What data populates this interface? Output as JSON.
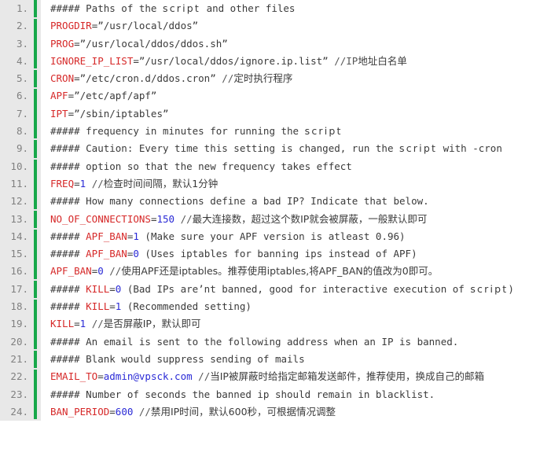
{
  "editor": {
    "kind": "code-listing",
    "language": "shell-config",
    "colors": {
      "background": "#ffffff",
      "gutter_background": "#e8e8e8",
      "gutter_text": "#808080",
      "marker_green": "#17a84a",
      "variable_red": "#d62929",
      "number_blue": "#2a2ad6",
      "comment_gray": "#555555",
      "plain_text": "#3a3a3a"
    },
    "lines": [
      {
        "number": "1.",
        "tokens": [
          {
            "t": "##### Paths of the ",
            "c": "plain"
          },
          {
            "t": "script",
            "c": "script"
          },
          {
            "t": " and other files",
            "c": "plain"
          }
        ]
      },
      {
        "number": "2.",
        "tokens": [
          {
            "t": "PROGDIR",
            "c": "var"
          },
          {
            "t": "=”/usr/local/ddos”",
            "c": "plain"
          }
        ]
      },
      {
        "number": "3.",
        "tokens": [
          {
            "t": "PROG",
            "c": "var"
          },
          {
            "t": "=”/usr/local/ddos/ddos.sh”",
            "c": "plain"
          }
        ]
      },
      {
        "number": "4.",
        "tokens": [
          {
            "t": "IGNORE_IP_LIST",
            "c": "var"
          },
          {
            "t": "=”/usr/local/ddos/ignore.ip.list” ",
            "c": "plain"
          },
          {
            "t": "//IP",
            "c": "comment"
          },
          {
            "t": "地址白名单",
            "c": "cn"
          }
        ]
      },
      {
        "number": "5.",
        "tokens": [
          {
            "t": "CRON",
            "c": "var"
          },
          {
            "t": "=”/etc/cron.d/ddos.cron” ",
            "c": "plain"
          },
          {
            "t": "//",
            "c": "comment"
          },
          {
            "t": "定时执行程序",
            "c": "cn"
          }
        ]
      },
      {
        "number": "6.",
        "tokens": [
          {
            "t": "APF",
            "c": "var"
          },
          {
            "t": "=”/etc/apf/apf”",
            "c": "plain"
          }
        ]
      },
      {
        "number": "7.",
        "tokens": [
          {
            "t": "IPT",
            "c": "var"
          },
          {
            "t": "=”/sbin/iptables”",
            "c": "plain"
          }
        ]
      },
      {
        "number": "8.",
        "tokens": [
          {
            "t": "##### frequency in minutes for running the ",
            "c": "plain"
          },
          {
            "t": "script",
            "c": "script"
          }
        ]
      },
      {
        "number": "9.",
        "tokens": [
          {
            "t": "##### Caution: Every time this setting is changed, run the ",
            "c": "plain"
          },
          {
            "t": "script",
            "c": "script"
          },
          {
            "t": " with -cron",
            "c": "plain"
          }
        ]
      },
      {
        "number": "10.",
        "tokens": [
          {
            "t": "##### option so that the new frequency takes effect",
            "c": "plain"
          }
        ]
      },
      {
        "number": "11.",
        "tokens": [
          {
            "t": "FREQ",
            "c": "var"
          },
          {
            "t": "=",
            "c": "plain"
          },
          {
            "t": "1",
            "c": "num"
          },
          {
            "t": " //",
            "c": "comment"
          },
          {
            "t": "检查时间间隔，默认1分钟",
            "c": "cn"
          }
        ]
      },
      {
        "number": "12.",
        "tokens": [
          {
            "t": "##### How many connections define a bad IP? Indicate that below.",
            "c": "plain"
          }
        ]
      },
      {
        "number": "13.",
        "tokens": [
          {
            "t": "NO_OF_CONNECTIONS",
            "c": "var"
          },
          {
            "t": "=",
            "c": "plain"
          },
          {
            "t": "150",
            "c": "num"
          },
          {
            "t": " //",
            "c": "comment"
          },
          {
            "t": "最大连接数，超过这个数IP就会被屏蔽，一般默认即可",
            "c": "cn"
          }
        ]
      },
      {
        "number": "14.",
        "tokens": [
          {
            "t": "##### ",
            "c": "plain"
          },
          {
            "t": "APF_BAN",
            "c": "var"
          },
          {
            "t": "=",
            "c": "plain"
          },
          {
            "t": "1",
            "c": "num"
          },
          {
            "t": " (Make sure your APF version is atleast 0.96)",
            "c": "plain"
          }
        ]
      },
      {
        "number": "15.",
        "tokens": [
          {
            "t": "##### ",
            "c": "plain"
          },
          {
            "t": "APF_BAN",
            "c": "var"
          },
          {
            "t": "=",
            "c": "plain"
          },
          {
            "t": "0",
            "c": "num"
          },
          {
            "t": " (Uses iptables for banning ips instead of APF)",
            "c": "plain"
          }
        ]
      },
      {
        "number": "16.",
        "tokens": [
          {
            "t": "APF_BAN",
            "c": "var"
          },
          {
            "t": "=",
            "c": "plain"
          },
          {
            "t": "0",
            "c": "num"
          },
          {
            "t": " //",
            "c": "comment"
          },
          {
            "t": "使用APF还是iptables。推荐使用iptables,将APF_BAN的值改为0即可。",
            "c": "cn"
          }
        ]
      },
      {
        "number": "17.",
        "tokens": [
          {
            "t": "##### ",
            "c": "plain"
          },
          {
            "t": "KILL",
            "c": "var"
          },
          {
            "t": "=",
            "c": "plain"
          },
          {
            "t": "0",
            "c": "num"
          },
          {
            "t": " (Bad IPs are’nt banned, good for interactive execution of ",
            "c": "plain"
          },
          {
            "t": "script",
            "c": "script"
          },
          {
            "t": ")",
            "c": "plain"
          }
        ]
      },
      {
        "number": "18.",
        "tokens": [
          {
            "t": "##### ",
            "c": "plain"
          },
          {
            "t": "KILL",
            "c": "var"
          },
          {
            "t": "=",
            "c": "plain"
          },
          {
            "t": "1",
            "c": "num"
          },
          {
            "t": " (Recommended setting)",
            "c": "plain"
          }
        ]
      },
      {
        "number": "19.",
        "tokens": [
          {
            "t": "KILL",
            "c": "var"
          },
          {
            "t": "=",
            "c": "plain"
          },
          {
            "t": "1",
            "c": "num"
          },
          {
            "t": " //",
            "c": "comment"
          },
          {
            "t": "是否屏蔽IP，默认即可",
            "c": "cn"
          }
        ]
      },
      {
        "number": "20.",
        "tokens": [
          {
            "t": "##### An email is sent to the following address when an IP is banned.",
            "c": "plain"
          }
        ]
      },
      {
        "number": "21.",
        "tokens": [
          {
            "t": "##### Blank would suppress sending of mails",
            "c": "plain"
          }
        ]
      },
      {
        "number": "22.",
        "tokens": [
          {
            "t": "EMAIL_TO",
            "c": "var"
          },
          {
            "t": "=",
            "c": "plain"
          },
          {
            "t": "admin@vpsck.com",
            "c": "num"
          },
          {
            "t": " //",
            "c": "comment"
          },
          {
            "t": "当IP被屏蔽时给指定邮箱发送邮件，推荐使用，换成自己的邮箱",
            "c": "cn"
          }
        ]
      },
      {
        "number": "23.",
        "tokens": [
          {
            "t": "##### Number of seconds the banned ip should remain in blacklist.",
            "c": "plain"
          }
        ]
      },
      {
        "number": "24.",
        "tokens": [
          {
            "t": "BAN_PERIOD",
            "c": "var"
          },
          {
            "t": "=",
            "c": "plain"
          },
          {
            "t": "600",
            "c": "num"
          },
          {
            "t": " //",
            "c": "comment"
          },
          {
            "t": "禁用IP时间，默认600秒，可根据情况调整",
            "c": "cn"
          }
        ]
      }
    ]
  }
}
